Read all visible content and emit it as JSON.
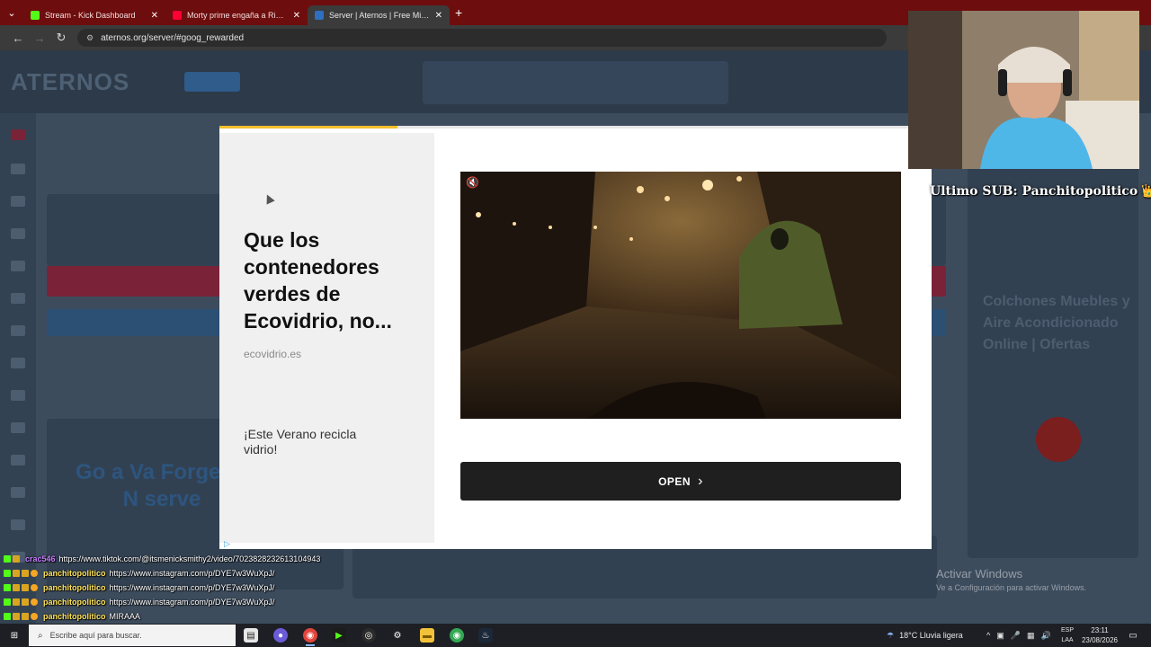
{
  "browser": {
    "tabs": [
      {
        "title": "Stream - Kick Dashboard",
        "color": "#53fc18"
      },
      {
        "title": "Morty prime engaña a Rick #sh",
        "color": "#ff0033"
      },
      {
        "title": "Server | Aternos | Free Minecraft",
        "color": "#2f6fbf"
      }
    ],
    "url": "aternos.org/server/#goog_rewarded"
  },
  "page_bg": {
    "logo": "ATERNOS",
    "big_text": "Go a Va Forge or N serve",
    "side_text": "Colchones Muebles y Aire Acondicionado Online | Ofertas"
  },
  "ad": {
    "headline": "Que los contenedores verdes de Ecovidrio, no...",
    "domain": "ecovidrio.es",
    "description": "¡Este Verano recicla vidrio!",
    "cta": "OPEN",
    "progress": 0.25
  },
  "overlay": {
    "last_sub": "Ultimo SUB: Panchitopolitico",
    "crown": "👑"
  },
  "chat": [
    {
      "user": "crac546",
      "user_color": "#c77dff",
      "text": "https://www.tiktok.com/@itsmenicksmithy2/video/7023828232613104943"
    },
    {
      "user": "panchitopolitico",
      "user_color": "#ffe45c",
      "text": "https://www.instagram.com/p/DYE7w3WuXpJ/"
    },
    {
      "user": "panchitopolitico",
      "user_color": "#ffe45c",
      "text": "https://www.instagram.com/p/DYE7w3WuXpJ/"
    },
    {
      "user": "panchitopolitico",
      "user_color": "#ffe45c",
      "text": "https://www.instagram.com/p/DYE7w3WuXpJ/"
    },
    {
      "user": "panchitopolitico",
      "user_color": "#ffe45c",
      "text": "MIRAAA"
    }
  ],
  "watermark": {
    "line1": "Activar Windows",
    "line2": "Ve a Configuración para activar Windows."
  },
  "taskbar": {
    "search_placeholder": "Escribe aquí para buscar.",
    "weather": "18°C  Lluvia ligera",
    "lang_top": "ESP",
    "lang_bottom": "LAA",
    "time": "23:11",
    "date": "23/08/2026"
  }
}
